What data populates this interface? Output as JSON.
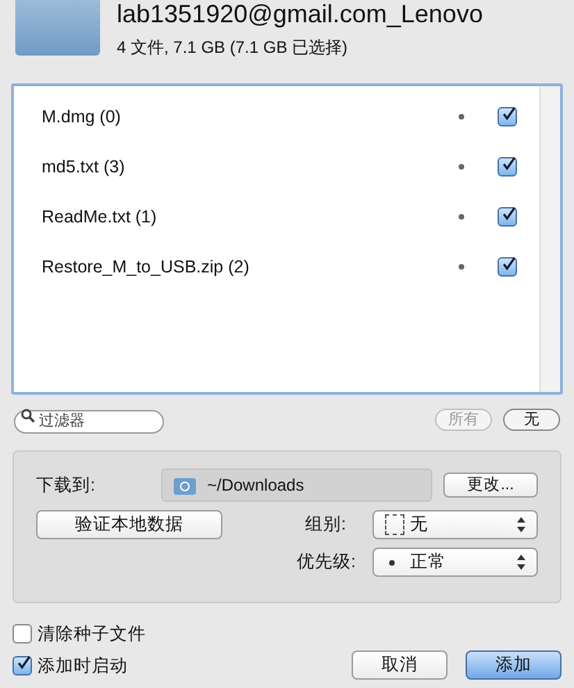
{
  "header": {
    "title": "lab1351920@gmail.com_Lenovo",
    "summary": "4 文件, 7.1 GB (7.1 GB 已选择)"
  },
  "files": [
    {
      "name": "M.dmg (0)",
      "checked": true
    },
    {
      "name": "md5.txt (3)",
      "checked": true
    },
    {
      "name": "ReadMe.txt (1)",
      "checked": true
    },
    {
      "name": "Restore_M_to_USB.zip (2)",
      "checked": true
    }
  ],
  "filter": {
    "placeholder": "过滤器"
  },
  "select_buttons": [
    {
      "label": "所有",
      "disabled": true
    },
    {
      "label": "无",
      "disabled": false
    }
  ],
  "download": {
    "label": "下载到:",
    "path": "~/Downloads",
    "change_button": "更改..."
  },
  "verify_button": "验证本地数据",
  "group": {
    "label": "组别:",
    "value": "无"
  },
  "priority": {
    "label": "优先级:",
    "value": "正常"
  },
  "options": [
    {
      "label": "清除种子文件",
      "checked": false
    },
    {
      "label": "添加时启动",
      "checked": true
    }
  ],
  "buttons": [
    {
      "label": "取消",
      "kind": "normal"
    },
    {
      "label": "添加",
      "kind": "default"
    }
  ]
}
